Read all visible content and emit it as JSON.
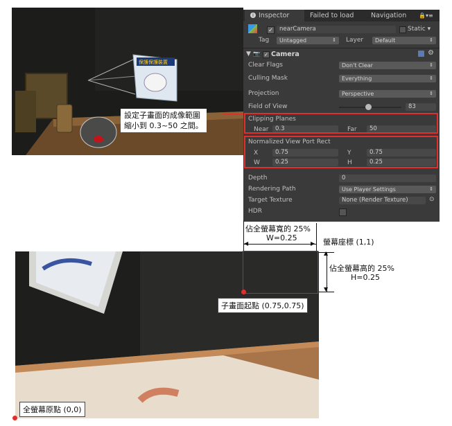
{
  "inspector": {
    "tabs": [
      "Inspector",
      "Failed to load",
      "Navigation"
    ],
    "object_name": "nearCamera",
    "static_label": "Static",
    "tag_label": "Tag",
    "tag_value": "Untagged",
    "layer_label": "Layer",
    "layer_value": "Default",
    "component_name": "Camera",
    "clear_flags": {
      "label": "Clear Flags",
      "value": "Don't Clear"
    },
    "culling_mask": {
      "label": "Culling Mask",
      "value": "Everything"
    },
    "projection": {
      "label": "Projection",
      "value": "Perspective"
    },
    "field_of_view": {
      "label": "Field of View",
      "value": "83"
    },
    "clipping_planes": {
      "label": "Clipping Planes",
      "near_label": "Near",
      "near_value": "0.3",
      "far_label": "Far",
      "far_value": "50"
    },
    "viewport_rect": {
      "label": "Normalized View Port Rect",
      "x_label": "X",
      "x_value": "0.75",
      "y_label": "Y",
      "y_value": "0.75",
      "w_label": "W",
      "w_value": "0.25",
      "h_label": "H",
      "h_value": "0.25"
    },
    "depth": {
      "label": "Depth",
      "value": "0"
    },
    "rendering_path": {
      "label": "Rendering Path",
      "value": "Use Player Settings"
    },
    "target_texture": {
      "label": "Target Texture",
      "value": "None (Render Texture)"
    },
    "hdr": {
      "label": "HDR"
    }
  },
  "annotations": {
    "clip_note_line1": "設定子畫面的成像範圍",
    "clip_note_line2": "縮小到 0.3~50 之間。",
    "width_note_line1": "佔全螢幕寬的 25%",
    "width_note_line2": "W=0.25",
    "screen_coord": "螢幕座標 (1,1)",
    "height_note_line1": "佔全螢幕高的 25%",
    "height_note_line2": "H=0.25",
    "sub_origin": "子畫面起點 (0.75,0.75)",
    "full_origin": "全螢幕原點 (0,0)"
  },
  "scene": {
    "sign_text": "保護保護裝置"
  },
  "colors": {
    "highlight": "#e0302e",
    "inspector_bg": "#3a3a3a"
  }
}
